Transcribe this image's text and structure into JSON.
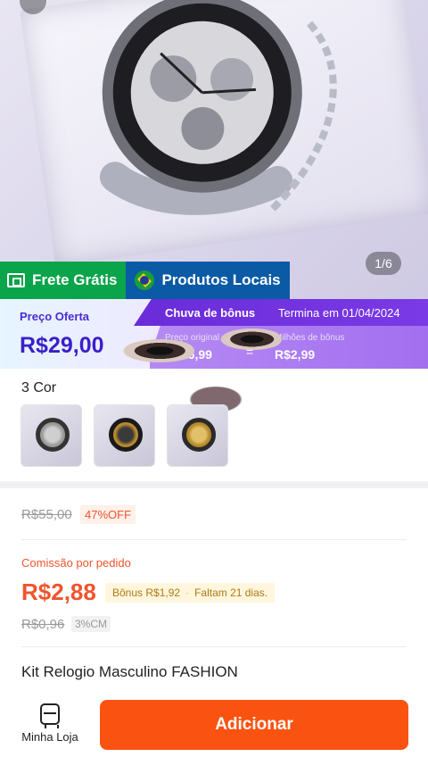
{
  "gallery": {
    "counter": "1/6"
  },
  "badges": {
    "free_shipping": "Frete Grátis",
    "local_products": "Produtos Locais"
  },
  "price_banner": {
    "offer_label": "Preço Oferta",
    "offer_price": "R$29,00",
    "bonus_title": "Chuva de bônus",
    "ends": "Termina em 01/04/2024",
    "original_label": "Preço original",
    "original_value": "R$26,99",
    "bonus_label": "Milhões de bônus",
    "bonus_value": "R$2,99",
    "separator": "="
  },
  "variants": {
    "title": "3 Cor",
    "items": [
      {
        "name": "silver"
      },
      {
        "name": "black-gold"
      },
      {
        "name": "gold"
      }
    ]
  },
  "pricing": {
    "old_price": "R$55,00",
    "discount": "47%OFF",
    "commission_label": "Comissão por pedido",
    "commission_value": "R$2,88",
    "bonus": "Bônus R$1,92",
    "remaining": "Faltam 21 dias.",
    "old_commission": "R$0,96",
    "commission_rate": "3%CM"
  },
  "product": {
    "title": "Kit Relogio Masculino FASHION"
  },
  "bottom_bar": {
    "store_label": "Minha Loja",
    "add_label": "Adicionar"
  },
  "colors": {
    "primary": "#fa5311",
    "accent_purple": "#7a3ae6",
    "green": "#0aa44a",
    "blue": "#0b5aa6"
  }
}
